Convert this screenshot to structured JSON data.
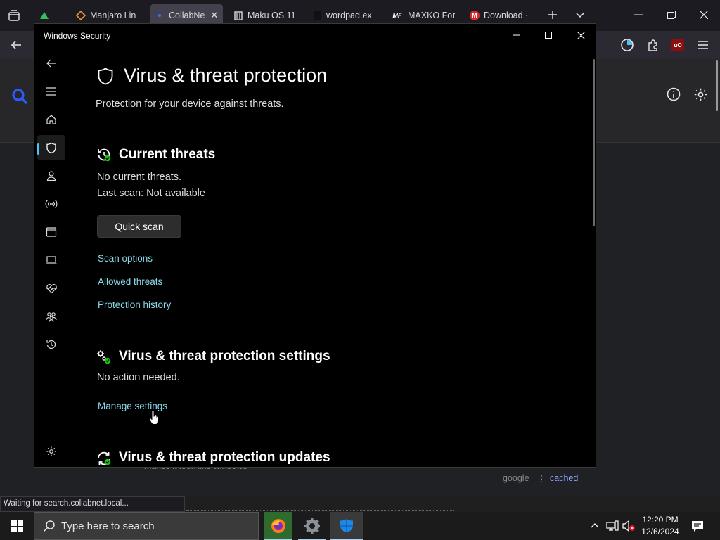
{
  "browser": {
    "tabs": [
      {
        "label": "",
        "icon": "manjaro-icon"
      },
      {
        "label": "Manjaro Lin",
        "icon": "diamond-icon"
      },
      {
        "label": "CollabNe",
        "icon": "collabnet-icon",
        "active": true
      },
      {
        "label": "Maku OS 11",
        "icon": "building-icon"
      },
      {
        "label": "wordpad.ex",
        "icon": "file-icon"
      },
      {
        "label": "MAXKO For",
        "icon": "mf-icon"
      },
      {
        "label": "Download ·",
        "icon": "mega-icon"
      }
    ],
    "mf_badge": "MF",
    "mega_badge": "M",
    "ublock_badge": "uO",
    "footer": {
      "google": "google",
      "separator": "⋮",
      "cached": "cached"
    },
    "behind_text": "makes it look like windows",
    "status_text": "Waiting for search.collabnet.local..."
  },
  "security_window": {
    "title": "Windows Security",
    "heading": "Virus & threat protection",
    "subtitle": "Protection for your device against threats.",
    "current_threats": {
      "heading": "Current threats",
      "status": "No current threats.",
      "last_scan": "Last scan: Not available",
      "quick_scan_label": "Quick scan",
      "links": [
        "Scan options",
        "Allowed threats",
        "Protection history"
      ]
    },
    "settings": {
      "heading": "Virus & threat protection settings",
      "status": "No action needed.",
      "manage_label": "Manage settings"
    },
    "updates": {
      "heading": "Virus & threat protection updates"
    }
  },
  "taskbar": {
    "search_placeholder": "Type here to search",
    "time": "12:20 PM",
    "date": "12/6/2024"
  },
  "colors": {
    "accent": "#4cc2ff",
    "link": "#8ad9ea",
    "window_bg": "#000000",
    "ok_green": "#16c60c"
  }
}
